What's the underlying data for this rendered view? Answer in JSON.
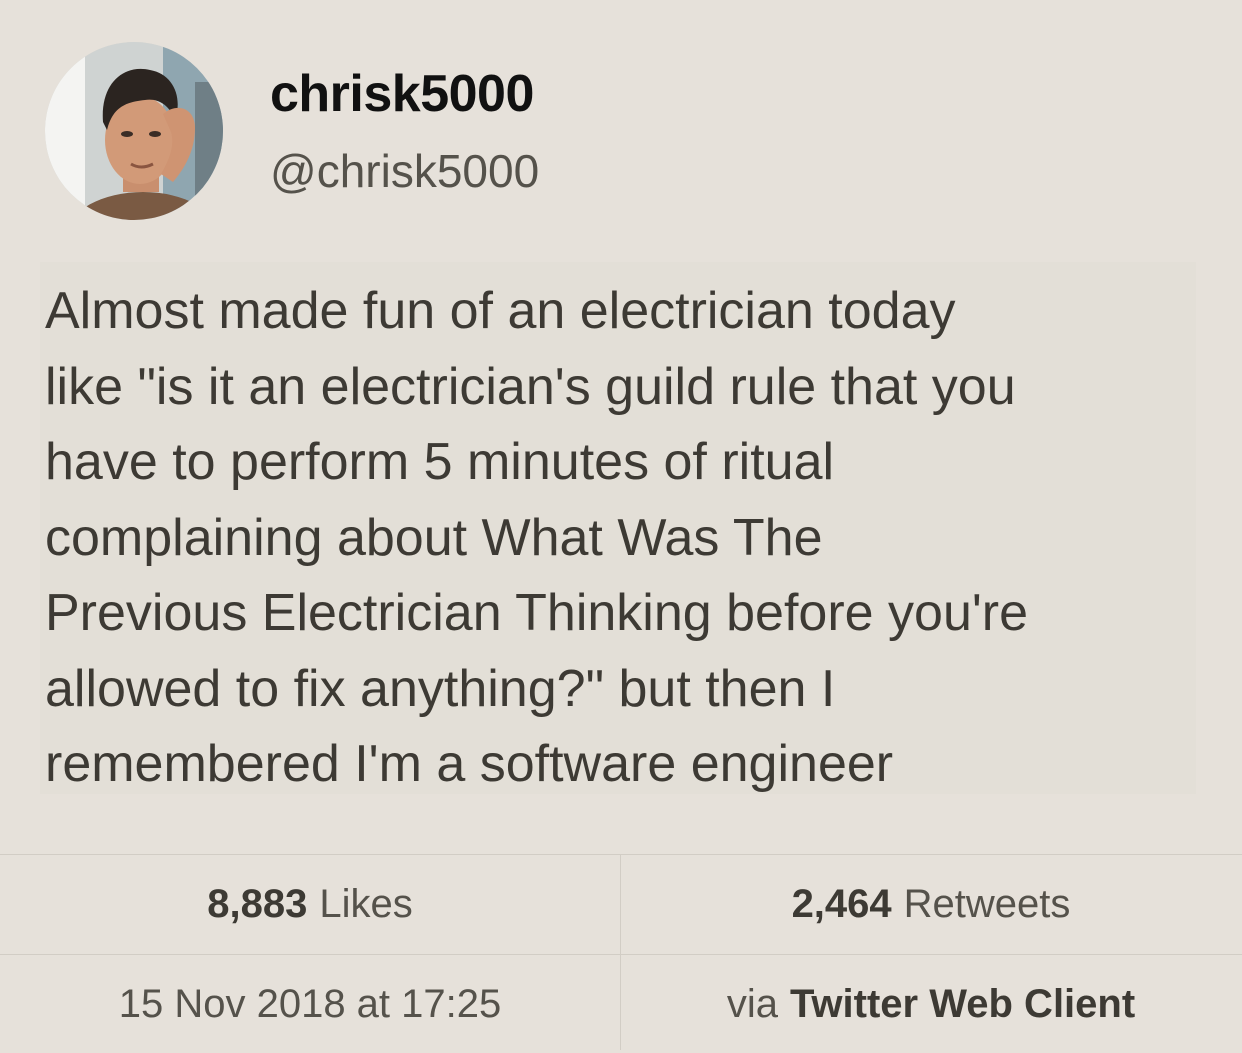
{
  "author": {
    "display_name": "chrisk5000",
    "handle": "@chrisk5000",
    "avatar_icon": "profile-photo-man-hand-on-head"
  },
  "tweet": {
    "lines": [
      "Almost made fun of an electrician today",
      "like \"is it an electrician's guild rule that you",
      "have to perform 5 minutes of ritual",
      "complaining about What Was The",
      "Previous Electrician Thinking before you're",
      "allowed to fix anything?\" but then I",
      "remembered I'm a software engineer"
    ]
  },
  "stats": {
    "likes_count": "8,883",
    "likes_label": "Likes",
    "retweets_count": "2,464",
    "retweets_label": "Retweets",
    "timestamp": "15 Nov 2018 at 17:25",
    "via_label": "via",
    "client_name": "Twitter Web Client"
  },
  "colors": {
    "background": "#e6e1da",
    "text": "#3d3a34",
    "name": "#111111",
    "secondary": "#55524b",
    "divider": "#d2cdc5"
  }
}
